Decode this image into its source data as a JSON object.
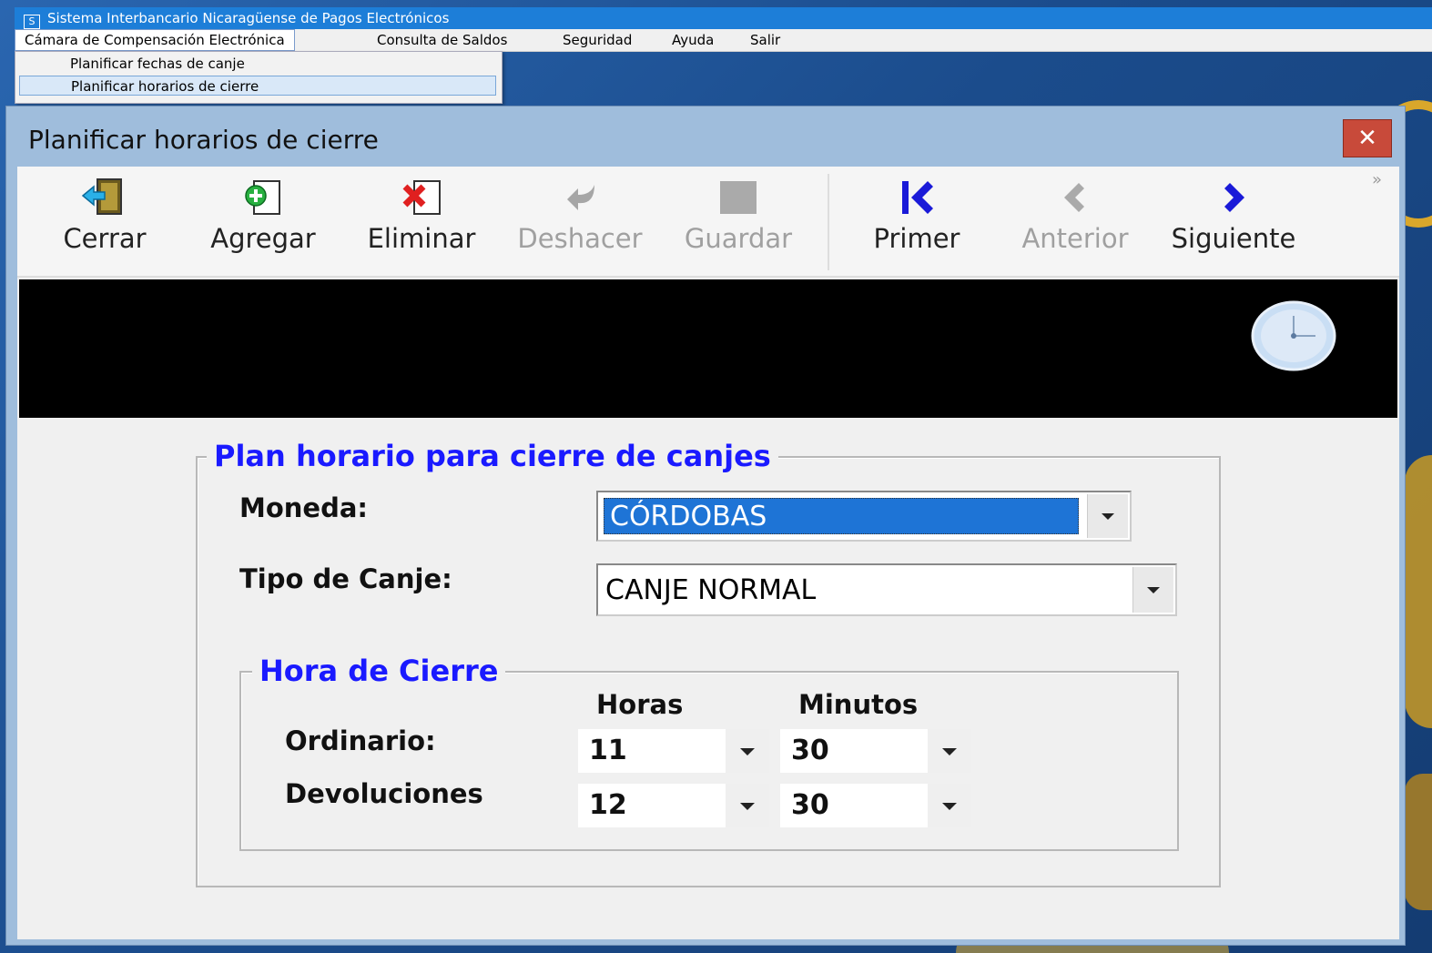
{
  "window": {
    "title": "Sistema Interbancario  Nicaragüense de Pagos Electrónicos",
    "icon": "app-icon"
  },
  "menubar": {
    "items": [
      {
        "label": "Cámara de Compensación Electrónica",
        "active": true
      },
      {
        "label": "Consulta de Saldos"
      },
      {
        "label": "Seguridad"
      },
      {
        "label": "Ayuda"
      },
      {
        "label": "Salir"
      }
    ]
  },
  "dropdown": {
    "items": [
      {
        "label": "Planificar fechas de canje"
      },
      {
        "label": "Planificar horarios de cierre",
        "highlighted": true
      }
    ]
  },
  "dialog": {
    "title": "Planificar horarios de cierre",
    "close_icon": "close-icon"
  },
  "toolbar": {
    "cerrar": "Cerrar",
    "agregar": "Agregar",
    "eliminar": "Eliminar",
    "deshacer": "Deshacer",
    "guardar": "Guardar",
    "primer": "Primer",
    "anterior": "Anterior",
    "siguiente": "Siguiente",
    "overflow": "»"
  },
  "plan": {
    "title": "Plan horario para cierre de canjes",
    "moneda_label": "Moneda:",
    "moneda_value": "CÓRDOBAS",
    "tipo_label": "Tipo de Canje:",
    "tipo_value": "CANJE NORMAL"
  },
  "cierre": {
    "title": "Hora de Cierre",
    "horas_header": "Horas",
    "minutos_header": "Minutos",
    "ordinario_label": "Ordinario:",
    "ordinario_horas": "11",
    "ordinario_minutos": "30",
    "devoluciones_label": "Devoluciones",
    "devoluciones_horas": "12",
    "devoluciones_minutos": "30"
  },
  "colors": {
    "accent_blue": "#1a1aff",
    "selection": "#1e74d6",
    "close_red": "#c84a3a"
  }
}
